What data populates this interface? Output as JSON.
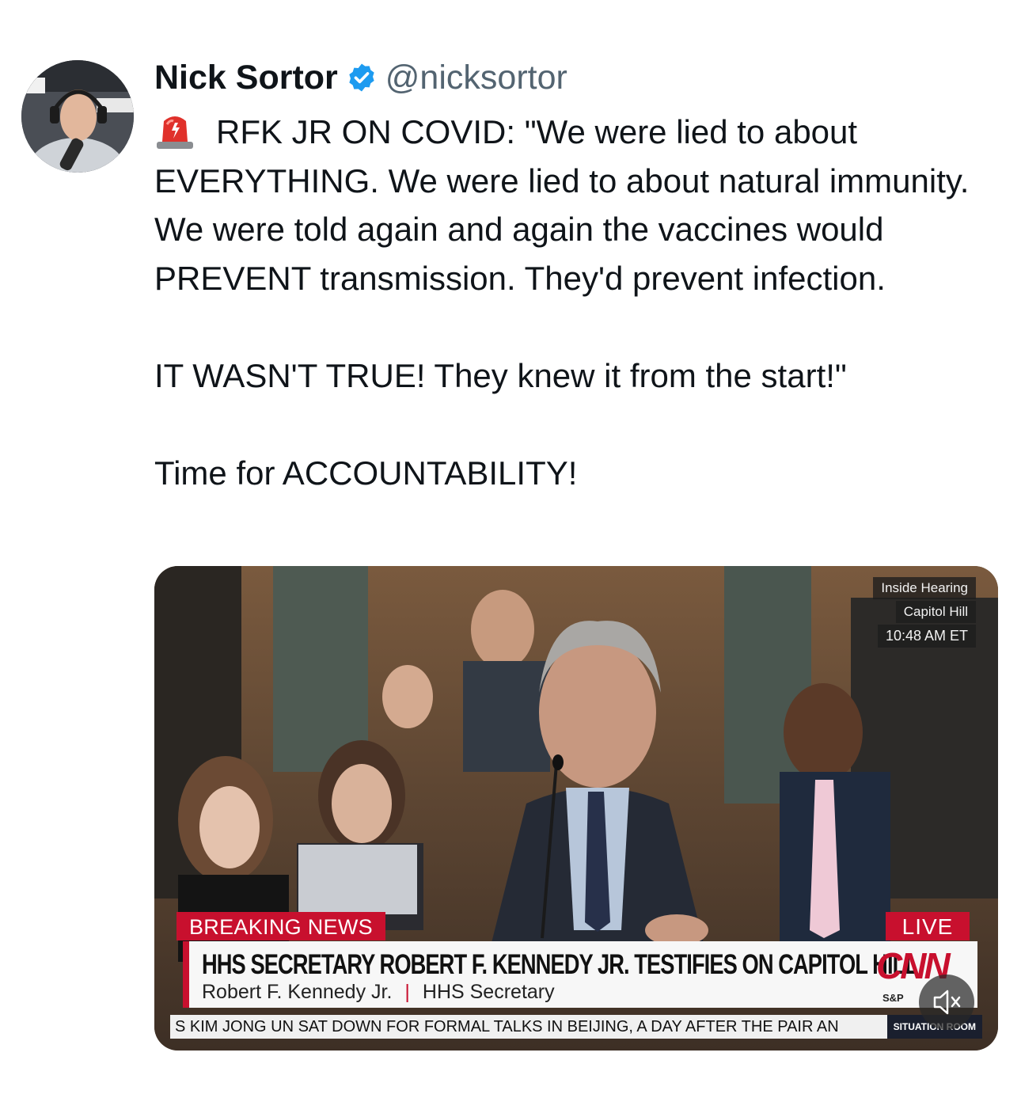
{
  "author": {
    "name": "Nick Sortor",
    "handle": "@nicksortor",
    "verified": true,
    "avatar_icon": "avatar-photo"
  },
  "tweet": {
    "line1": "RFK JR ON COVID: \"We were lied to about EVERYTHING. We were lied to about natural immunity. We were told again and again the vaccines would PREVENT transmission. They'd prevent infection.",
    "line2": "IT WASN'T TRUE! They knew it from the start!\"",
    "line3": "Time for ACCOUNTABILITY!",
    "leading_icon": "police-siren-emoji"
  },
  "video": {
    "overlay_location1": "Inside Hearing",
    "overlay_location2": "Capitol Hill",
    "overlay_time": "10:48 AM ET",
    "breaking_label": "BREAKING NEWS",
    "live_label": "LIVE",
    "headline": "HHS SECRETARY ROBERT F. KENNEDY JR. TESTIFIES ON CAPITOL HILL",
    "person_name": "Robert F. Kennedy Jr.",
    "person_separator": "|",
    "person_title": "HHS Secretary",
    "network_logo": "CNN",
    "market_label": "S&P",
    "ticker": "S KIM JONG UN SAT DOWN FOR FORMAL TALKS IN BEIJING, A DAY AFTER THE PAIR AN",
    "ticker_brand": "SITUATION ROOM",
    "mute_icon": "speaker-muted-icon"
  },
  "colors": {
    "verified": "#1d9bf0",
    "cnn_red": "#c8102e",
    "handle": "#536471"
  }
}
